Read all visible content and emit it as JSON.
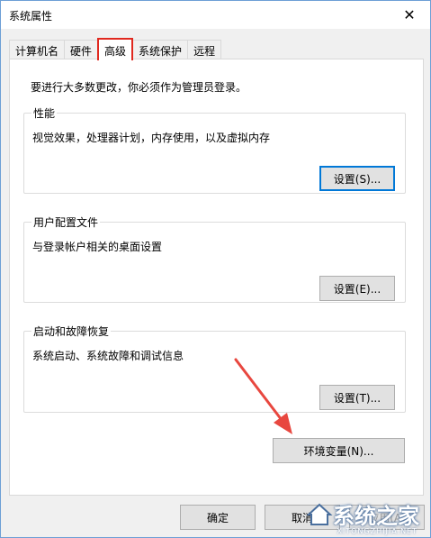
{
  "window": {
    "title": "系统属性",
    "close_glyph": "✕"
  },
  "tabs": [
    {
      "label": "计算机名",
      "active": false
    },
    {
      "label": "硬件",
      "active": false
    },
    {
      "label": "高级",
      "active": true
    },
    {
      "label": "系统保护",
      "active": false
    },
    {
      "label": "远程",
      "active": false
    }
  ],
  "panel": {
    "intro": "要进行大多数更改，你必须作为管理员登录。",
    "performance": {
      "title": "性能",
      "description": "视觉效果，处理器计划，内存使用，以及虚拟内存",
      "button": "设置(S)..."
    },
    "user_profiles": {
      "title": "用户配置文件",
      "description": "与登录帐户相关的桌面设置",
      "button": "设置(E)..."
    },
    "startup_recovery": {
      "title": "启动和故障恢复",
      "description": "系统启动、系统故障和调试信息",
      "button": "设置(T)..."
    },
    "env_button": "环境变量(N)..."
  },
  "footer": {
    "ok": "确定",
    "cancel": "取消",
    "apply": "应用(A)"
  },
  "annotation": {
    "highlight_color": "#e0281e",
    "arrow_color": "#e8473f"
  },
  "watermark": {
    "text": "系统之家",
    "sub": "XITONGZHIJIA.NET"
  }
}
